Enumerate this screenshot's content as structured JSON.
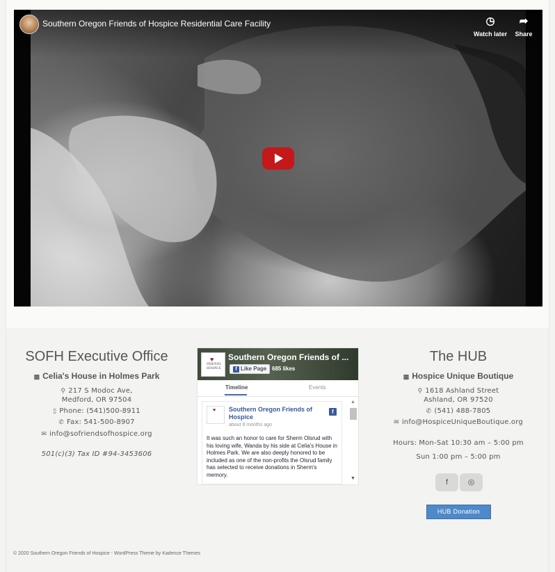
{
  "video": {
    "title": "Southern Oregon Friends of Hospice Residential Care Facility",
    "watch_later_label": "Watch later",
    "share_label": "Share"
  },
  "executive_office": {
    "title": "SOFH Executive Office",
    "location_name": "Celia's House in Holmes Park",
    "address_line1": "217 S Modoc Ave,",
    "address_line2": "Medford, OR 97504",
    "phone": "Phone: (541)500-8911",
    "fax": "Fax: 541-500-8907",
    "email": "info@sofriendsofhospice.org",
    "tax_id": "501(c)(3) Tax ID #94-3453606"
  },
  "facebook": {
    "page_name": "Southern Oregon Friends of ...",
    "like_label": "Like Page",
    "likes": "685 likes",
    "logo_text": "FRIENDS HOSPICE",
    "tabs": [
      "Timeline",
      "Events"
    ],
    "post": {
      "author": "Southern Oregon Friends of Hospice",
      "time": "about 8 months ago",
      "text": "It was such an honor to care for Sherm Olsrud with his loving wife, Wanda by his side at Celia's House in Holmes Park. We are also deeply honored to be included as one of the non-profits the Olsrud family has selected to receive donations in Sherm's memory."
    }
  },
  "hub": {
    "title": "The HUB",
    "store_name": "Hospice Unique Boutique",
    "address_line1": "1618 Ashland Street",
    "address_line2": "Ashland, OR 97520",
    "phone": "(541) 488-7805",
    "email": "info@HospiceUniqueBoutique.org",
    "hours_line1": "Hours: Mon-Sat 10:30 am – 5:00 pm",
    "hours_line2": "Sun 1:00 pm – 5:00 pm",
    "social": [
      "facebook-icon",
      "instagram-icon"
    ],
    "donation_label": "HUB Donation"
  },
  "footer": {
    "copyright": "© 2020 Southern Oregon Friends of Hospice - WordPress Theme by",
    "theme_link": "Kadence Themes"
  }
}
